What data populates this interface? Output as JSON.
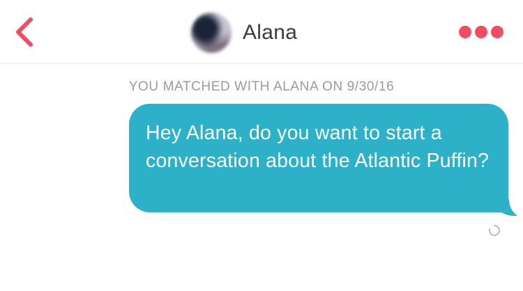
{
  "header": {
    "back_icon": "chevron-left-icon",
    "contact_name": "Alana",
    "more_icon": "more-dots-icon",
    "accent_color": "#f04d64"
  },
  "conversation": {
    "match_banner": "YOU MATCHED WITH ALANA ON 9/30/16",
    "messages": [
      {
        "sender": "me",
        "text": "Hey Alana, do you want to start a conversation about the Atlantic Puffin?",
        "bubble_color": "#2cb1c8",
        "status_icon": "sending-spinner-icon"
      }
    ]
  }
}
